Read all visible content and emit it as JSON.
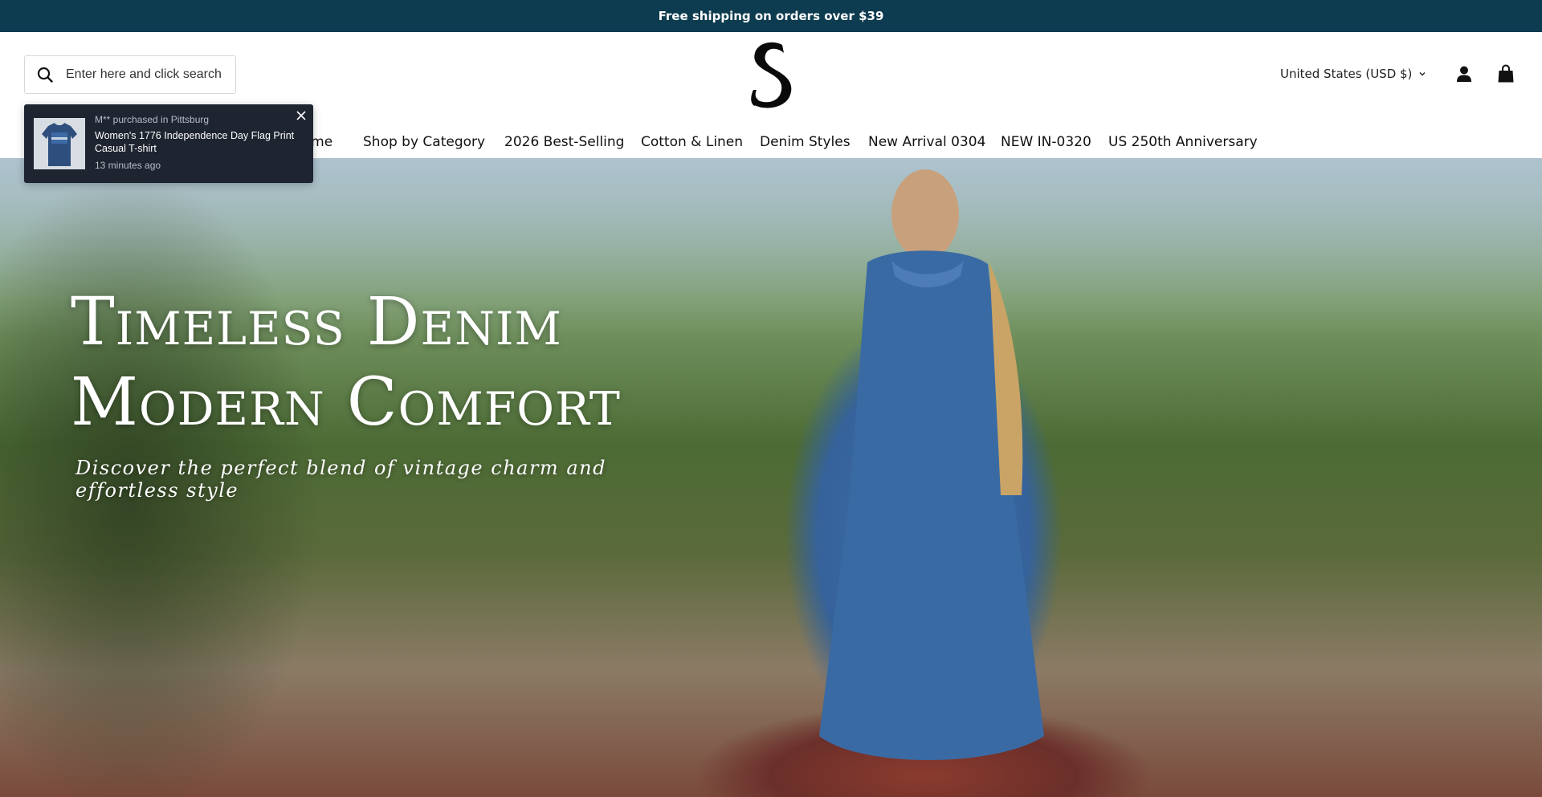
{
  "announcement": {
    "text": "Free shipping on orders over $39"
  },
  "header": {
    "search": {
      "placeholder": "Enter here and click search",
      "icon": "search-icon"
    },
    "logo": {
      "letter": "S"
    },
    "currency": {
      "label": "United States (USD $)"
    },
    "icons": [
      "account-icon",
      "cart-icon"
    ]
  },
  "nav": {
    "items": [
      {
        "label": "Home"
      },
      {
        "label": "Shop by Category"
      },
      {
        "label": "2026 Best-Selling"
      },
      {
        "label": "Cotton & Linen"
      },
      {
        "label": "Denim Styles"
      },
      {
        "label": "New Arrival 0304"
      },
      {
        "label": "NEW IN-0320"
      },
      {
        "label": "US 250th Anniversary"
      }
    ]
  },
  "popup": {
    "meta": "M** purchased in Pittsburg",
    "product": "Women's 1776 Independence Day Flag Print Casual T-shirt",
    "time": "13 minutes ago"
  },
  "hero": {
    "title_line1": "Timeless Denim",
    "title_line2": "Modern Comfort",
    "subtitle": "Discover the perfect blend of vintage charm and effortless style"
  },
  "colors": {
    "announcement_bg": "#0d3b4f",
    "popup_bg": "#1e2430"
  }
}
